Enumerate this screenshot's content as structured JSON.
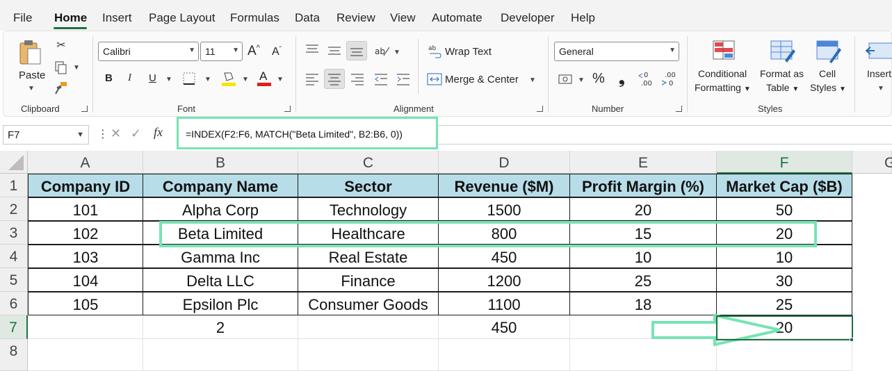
{
  "menu": {
    "tabs": [
      "File",
      "Home",
      "Insert",
      "Page Layout",
      "Formulas",
      "Data",
      "Review",
      "View",
      "Automate",
      "Developer",
      "Help"
    ],
    "active_tab": "Home"
  },
  "ribbon": {
    "clipboard": {
      "paste": "Paste",
      "label": "Clipboard"
    },
    "font": {
      "name": "Calibri",
      "size": "11",
      "grow": "A",
      "shrink": "A",
      "bold": "B",
      "italic": "I",
      "underline": "U",
      "color_letter": "A",
      "label": "Font"
    },
    "alignment": {
      "wrap_text": "Wrap Text",
      "merge_center": "Merge & Center",
      "label": "Alignment"
    },
    "number": {
      "format": "General",
      "percent": "%",
      "comma": "❟",
      "label": "Number"
    },
    "styles": {
      "conditional_1": "Conditional",
      "conditional_2": "Formatting",
      "table_1": "Format as",
      "table_2": "Table",
      "cell_1": "Cell",
      "cell_2": "Styles",
      "label": "Styles"
    },
    "cells": {
      "insert": "Insert"
    }
  },
  "formula_bar": {
    "name_box": "F7",
    "fx": "fx",
    "formula": "=INDEX(F2:F6, MATCH(\"Beta Limited\", B2:B6, 0))"
  },
  "sheet": {
    "columns": [
      "A",
      "B",
      "C",
      "D",
      "E",
      "F",
      "G"
    ],
    "rows": [
      "1",
      "2",
      "3",
      "4",
      "5",
      "6",
      "7",
      "8"
    ],
    "headers": [
      "Company ID",
      "Company Name",
      "Sector",
      "Revenue ($M)",
      "Profit Margin (%)",
      "Market Cap ($B)"
    ],
    "data": [
      [
        "101",
        "Alpha Corp",
        "Technology",
        "1500",
        "20",
        "50"
      ],
      [
        "102",
        "Beta Limited",
        "Healthcare",
        "800",
        "15",
        "20"
      ],
      [
        "103",
        "Gamma Inc",
        "Real Estate",
        "450",
        "10",
        "10"
      ],
      [
        "104",
        "Delta LLC",
        "Finance",
        "1200",
        "25",
        "30"
      ],
      [
        "105",
        "Epsilon Plc",
        "Consumer Goods",
        "1100",
        "18",
        "25"
      ]
    ],
    "row7": [
      "",
      "2",
      "",
      "450",
      "",
      "20"
    ]
  },
  "colors": {
    "accent": "#1e6f3f",
    "highlight": "#77e3b4",
    "header_fill": "#b7dde8"
  }
}
